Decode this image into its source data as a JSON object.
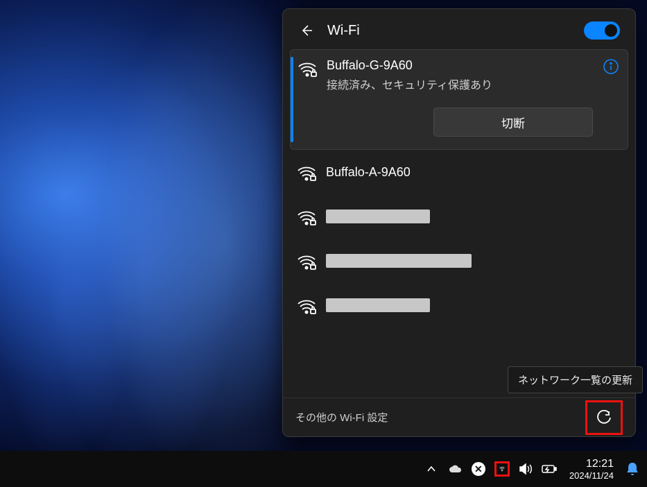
{
  "flyout": {
    "title": "Wi-Fi",
    "toggle_on": true,
    "connected": {
      "ssid": "Buffalo-G-9A60",
      "status": "接続済み、セキュリティ保護あり",
      "disconnect_label": "切断"
    },
    "networks": [
      {
        "ssid": "Buffalo-A-9A60",
        "secured": true
      },
      {
        "ssid": "",
        "secured": true,
        "redacted": true,
        "redact_width": 150
      },
      {
        "ssid": "",
        "secured": true,
        "redacted": true,
        "redact_width": 210
      },
      {
        "ssid": "",
        "secured": true,
        "redacted": true,
        "redact_width": 150
      }
    ],
    "more_settings": "その他の Wi-Fi 設定",
    "refresh_tooltip": "ネットワーク一覧の更新"
  },
  "taskbar": {
    "time": "12:21",
    "date": "2024/11/24"
  },
  "colors": {
    "accent": "#0a84ff",
    "highlight_box": "#e11"
  }
}
